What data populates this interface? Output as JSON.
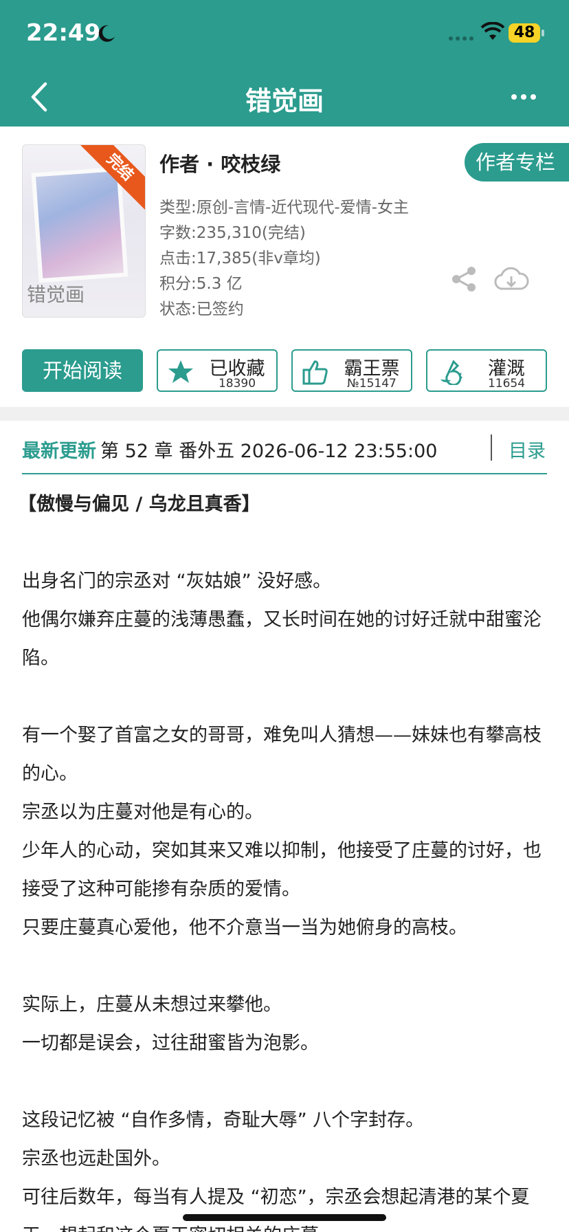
{
  "status": {
    "time": "22:49",
    "battery": "48"
  },
  "nav": {
    "title": "错觉画"
  },
  "book": {
    "cover_ribbon": "完结",
    "cover_title": "错觉画",
    "author": "作者 · 咬枝绿",
    "author_column": "作者专栏",
    "type": "类型:原创-言情-近代现代-爱情-女主",
    "words": "字数:235,310(完结)",
    "clicks": "点击:17,385(非v章均)",
    "points": "积分:5.3 亿",
    "state": "状态:已签约"
  },
  "actions": {
    "read": "开始阅读",
    "collect": {
      "label": "已收藏",
      "count": "18390"
    },
    "vote": {
      "label": "霸王票",
      "count": "№15147"
    },
    "water": {
      "label": "灌溉",
      "count": "11654"
    }
  },
  "update": {
    "label": "最新更新",
    "text": "第 52 章 番外五 2026-06-12 23:55:00",
    "toc": "目录"
  },
  "summary": [
    "【傲慢与偏见 / 乌龙且真香】",
    "",
    "出身名门的宗丞对 “灰姑娘” 没好感。",
    "他偶尔嫌弃庄蔓的浅薄愚蠢，又长时间在她的讨好迁就中甜蜜沦陷。",
    "",
    "有一个娶了首富之女的哥哥，难免叫人猜想——妹妹也有攀高枝的心。",
    "宗丞以为庄蔓对他是有心的。",
    "少年人的心动，突如其来又难以抑制，他接受了庄蔓的讨好，也接受了这种可能掺有杂质的爱情。",
    "只要庄蔓真心爱他，他不介意当一当为她俯身的高枝。",
    "",
    "实际上，庄蔓从未想过来攀他。",
    "一切都是误会，过往甜蜜皆为泡影。",
    "",
    "这段记忆被 “自作多情，奇耻大辱” 八个字封存。",
    "宗丞也远赴国外。",
    "可往后数年，每当有人提及 “初恋”，宗丞会想起清港的某个夏天，想起和这个夏天密切相关的庄蔓。"
  ]
}
